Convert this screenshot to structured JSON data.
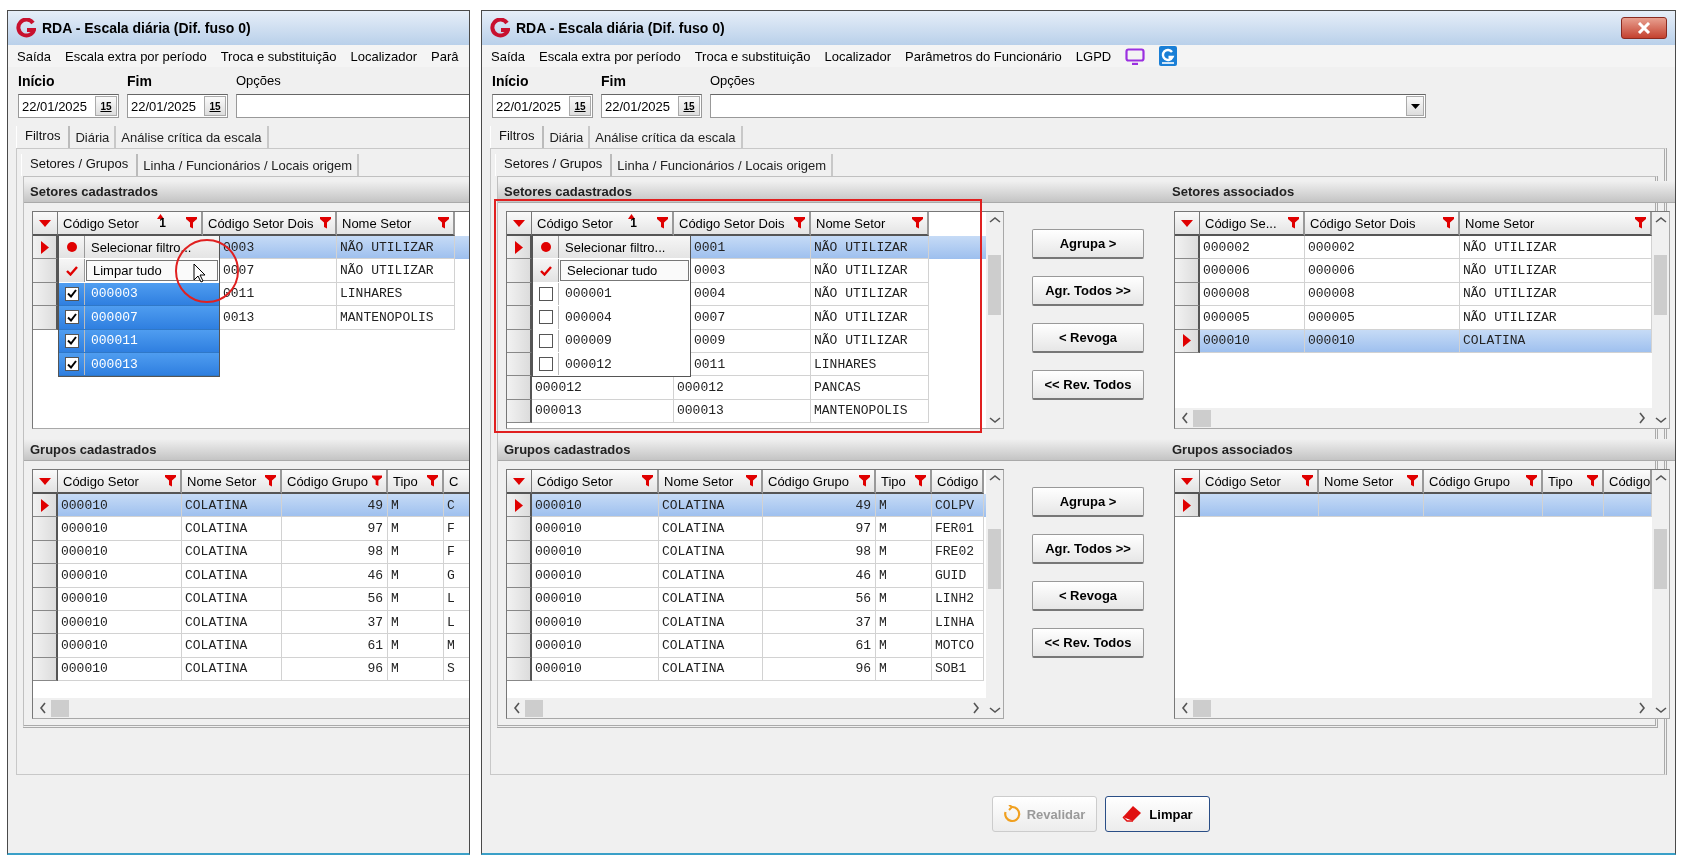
{
  "windows": [
    {
      "title": "RDA - Escala diária (Dif. fuso 0)",
      "menu": [
        {
          "kind": "text",
          "label": "Saída"
        },
        {
          "kind": "text",
          "label": "Escala extra por período"
        },
        {
          "kind": "text",
          "label": "Troca e substituição"
        },
        {
          "kind": "text",
          "label": "Localizador"
        },
        {
          "kind": "text",
          "label": "Parâ"
        }
      ],
      "dates": [
        {
          "label": "Início",
          "value": "22/01/2025",
          "button": "15"
        },
        {
          "label": "Fim",
          "value": "22/01/2025",
          "button": "15"
        }
      ],
      "options": {
        "label": "Opções"
      },
      "tabs": [
        {
          "label": "Filtros",
          "selected": true
        },
        {
          "label": "Diária",
          "selected": false
        },
        {
          "label": "Análise crítica da escala",
          "selected": false
        }
      ],
      "subtabs": [
        {
          "label": "Setores / Grupos",
          "selected": true
        },
        {
          "label": "Linha / Funcionários / Locais origem",
          "selected": false
        }
      ],
      "sections": [
        {
          "title": "Setores cadastrados",
          "grid": {
            "columns": [
              {
                "label": "Código Setor",
                "sort": "1",
                "filter": true
              },
              {
                "label": "Código Setor Dois",
                "filter": true
              },
              {
                "label": "Nome Setor",
                "filter": true
              }
            ],
            "rows": [
              {
                "selected": true,
                "cells": [
                  "",
                  "0003",
                  "NÃO UTILIZAR"
                ]
              },
              {
                "selected": false,
                "cells": [
                  "",
                  "0007",
                  "NÃO UTILIZAR"
                ]
              },
              {
                "selected": false,
                "cells": [
                  "",
                  "0011",
                  "LINHARES"
                ]
              },
              {
                "selected": false,
                "cells": [
                  "",
                  "0013",
                  "MANTENOPOLIS"
                ]
              }
            ],
            "popup": [
              {
                "kind": "filter",
                "label": "Selecionar filtro..."
              },
              {
                "kind": "all",
                "label": "Limpar tudo",
                "cursor": true
              },
              {
                "kind": "option",
                "label": "000003",
                "checked": true
              },
              {
                "kind": "option",
                "label": "000007",
                "checked": true
              },
              {
                "kind": "option",
                "label": "000011",
                "checked": true
              },
              {
                "kind": "option",
                "label": "000013",
                "checked": true
              }
            ]
          }
        },
        {
          "title": "Grupos cadastrados",
          "grid": {
            "columns": [
              {
                "label": "Código Setor",
                "filter": true
              },
              {
                "label": "Nome Setor",
                "filter": true
              },
              {
                "label": "Código Grupo",
                "filter": true
              },
              {
                "label": "Tipo",
                "filter": true
              },
              {
                "label": "C",
                "filter": false
              }
            ],
            "rows": [
              {
                "selected": true,
                "cells": [
                  "000010",
                  "COLATINA",
                  "49",
                  "M",
                  "C"
                ]
              },
              {
                "selected": false,
                "cells": [
                  "000010",
                  "COLATINA",
                  "97",
                  "M",
                  "F"
                ]
              },
              {
                "selected": false,
                "cells": [
                  "000010",
                  "COLATINA",
                  "98",
                  "M",
                  "F"
                ]
              },
              {
                "selected": false,
                "cells": [
                  "000010",
                  "COLATINA",
                  "46",
                  "M",
                  "G"
                ]
              },
              {
                "selected": false,
                "cells": [
                  "000010",
                  "COLATINA",
                  "56",
                  "M",
                  "L"
                ]
              },
              {
                "selected": false,
                "cells": [
                  "000010",
                  "COLATINA",
                  "37",
                  "M",
                  "L"
                ]
              },
              {
                "selected": false,
                "cells": [
                  "000010",
                  "COLATINA",
                  "61",
                  "M",
                  "M"
                ]
              },
              {
                "selected": false,
                "cells": [
                  "000010",
                  "COLATINA",
                  "96",
                  "M",
                  "S"
                ]
              }
            ]
          }
        }
      ]
    },
    {
      "title": "RDA - Escala diária (Dif. fuso 0)",
      "close_button": true,
      "menu": [
        {
          "kind": "text",
          "label": "Saída"
        },
        {
          "kind": "text",
          "label": "Escala extra por período"
        },
        {
          "kind": "text",
          "label": "Troca e substituição"
        },
        {
          "kind": "text",
          "label": "Localizador"
        },
        {
          "kind": "text",
          "label": "Parâmetros do Funcionário"
        },
        {
          "kind": "text",
          "label": "LGPD"
        },
        {
          "kind": "monitor"
        },
        {
          "kind": "logo"
        }
      ],
      "dates": [
        {
          "label": "Início",
          "value": "22/01/2025",
          "button": "15"
        },
        {
          "label": "Fim",
          "value": "22/01/2025",
          "button": "15"
        }
      ],
      "options": {
        "label": "Opções",
        "dropdown": true
      },
      "tabs": [
        {
          "label": "Filtros",
          "selected": true
        },
        {
          "label": "Diária",
          "selected": false
        },
        {
          "label": "Análise crítica da escala",
          "selected": false
        }
      ],
      "subtabs": [
        {
          "label": "Setores / Grupos",
          "selected": true
        },
        {
          "label": "Linha / Funcionários / Locais origem",
          "selected": false
        }
      ],
      "sections": [
        {
          "title": "Setores cadastrados",
          "grid": {
            "columns": [
              {
                "label": "Código Setor",
                "sort": "1",
                "filter": true
              },
              {
                "label": "Código Setor Dois",
                "filter": true
              },
              {
                "label": "Nome Setor",
                "filter": true
              }
            ],
            "rows": [
              {
                "selected": true,
                "cells": [
                  "",
                  "0001",
                  "NÃO UTILIZAR"
                ]
              },
              {
                "selected": false,
                "cells": [
                  "",
                  "0003",
                  "NÃO UTILIZAR"
                ]
              },
              {
                "selected": false,
                "cells": [
                  "",
                  "0004",
                  "NÃO UTILIZAR"
                ]
              },
              {
                "selected": false,
                "cells": [
                  "",
                  "0007",
                  "NÃO UTILIZAR"
                ]
              },
              {
                "selected": false,
                "cells": [
                  "",
                  "0009",
                  "NÃO UTILIZAR"
                ]
              },
              {
                "selected": false,
                "cells": [
                  "",
                  "0011",
                  "LINHARES"
                ]
              },
              {
                "selected": false,
                "cells": [
                  "000012",
                  "000012",
                  "PANCAS"
                ]
              },
              {
                "selected": false,
                "cells": [
                  "000013",
                  "000013",
                  "MANTENOPOLIS"
                ]
              }
            ],
            "popup": [
              {
                "kind": "filter",
                "label": "Selecionar filtro..."
              },
              {
                "kind": "all",
                "label": "Selecionar tudo"
              },
              {
                "kind": "option",
                "label": "000001",
                "checked": false
              },
              {
                "kind": "option",
                "label": "000004",
                "checked": false
              },
              {
                "kind": "option",
                "label": "000009",
                "checked": false
              },
              {
                "kind": "option",
                "label": "000012",
                "checked": false
              }
            ]
          },
          "actions": [
            {
              "label": "Agrupa >"
            },
            {
              "label": "Agr. Todos >>"
            },
            {
              "label": "< Revoga"
            },
            {
              "label": "<< Rev. Todos"
            }
          ],
          "associated": {
            "title": "Setores associados",
            "grid": {
              "columns": [
                {
                  "label": "Código Se...",
                  "filter": true
                },
                {
                  "label": "Código Setor Dois",
                  "filter": true
                },
                {
                  "label": "Nome Setor",
                  "filter": true
                }
              ],
              "rows": [
                {
                  "selected": false,
                  "cells": [
                    "000002",
                    "000002",
                    "NÃO UTILIZAR"
                  ]
                },
                {
                  "selected": false,
                  "cells": [
                    "000006",
                    "000006",
                    "NÃO UTILIZAR"
                  ]
                },
                {
                  "selected": false,
                  "cells": [
                    "000008",
                    "000008",
                    "NÃO UTILIZAR"
                  ]
                },
                {
                  "selected": false,
                  "cells": [
                    "000005",
                    "000005",
                    "NÃO UTILIZAR"
                  ]
                },
                {
                  "selected": true,
                  "cells": [
                    "000010",
                    "000010",
                    "COLATINA"
                  ]
                }
              ]
            }
          }
        },
        {
          "title": "Grupos cadastrados",
          "grid": {
            "columns": [
              {
                "label": "Código Setor",
                "filter": true
              },
              {
                "label": "Nome Setor",
                "filter": true
              },
              {
                "label": "Código Grupo",
                "filter": true
              },
              {
                "label": "Tipo",
                "filter": true
              },
              {
                "label": "Código",
                "filter": false
              }
            ],
            "rows": [
              {
                "selected": true,
                "cells": [
                  "000010",
                  "COLATINA",
                  "49",
                  "M",
                  "COLPV"
                ]
              },
              {
                "selected": false,
                "cells": [
                  "000010",
                  "COLATINA",
                  "97",
                  "M",
                  "FER01"
                ]
              },
              {
                "selected": false,
                "cells": [
                  "000010",
                  "COLATINA",
                  "98",
                  "M",
                  "FRE02"
                ]
              },
              {
                "selected": false,
                "cells": [
                  "000010",
                  "COLATINA",
                  "46",
                  "M",
                  "GUID"
                ]
              },
              {
                "selected": false,
                "cells": [
                  "000010",
                  "COLATINA",
                  "56",
                  "M",
                  "LINH2"
                ]
              },
              {
                "selected": false,
                "cells": [
                  "000010",
                  "COLATINA",
                  "37",
                  "M",
                  "LINHA"
                ]
              },
              {
                "selected": false,
                "cells": [
                  "000010",
                  "COLATINA",
                  "61",
                  "M",
                  "MOTCO"
                ]
              },
              {
                "selected": false,
                "cells": [
                  "000010",
                  "COLATINA",
                  "96",
                  "M",
                  "SOB1"
                ]
              }
            ]
          },
          "actions": [
            {
              "label": "Agrupa >"
            },
            {
              "label": "Agr. Todos >>"
            },
            {
              "label": "< Revoga"
            },
            {
              "label": "<< Rev. Todos"
            }
          ],
          "associated": {
            "title": "Grupos associados",
            "grid": {
              "columns": [
                {
                  "label": "Código Setor",
                  "filter": true
                },
                {
                  "label": "Nome Setor",
                  "filter": true
                },
                {
                  "label": "Código Grupo",
                  "filter": true
                },
                {
                  "label": "Tipo",
                  "filter": true
                },
                {
                  "label": "Código",
                  "filter": false
                }
              ],
              "rows": [
                {
                  "selected": true
                }
              ]
            }
          }
        }
      ],
      "footer_buttons": [
        {
          "kind": "refresh",
          "label": "Revalidar",
          "disabled": true
        },
        {
          "kind": "eraser",
          "label": "Limpar",
          "disabled": false
        }
      ]
    }
  ]
}
